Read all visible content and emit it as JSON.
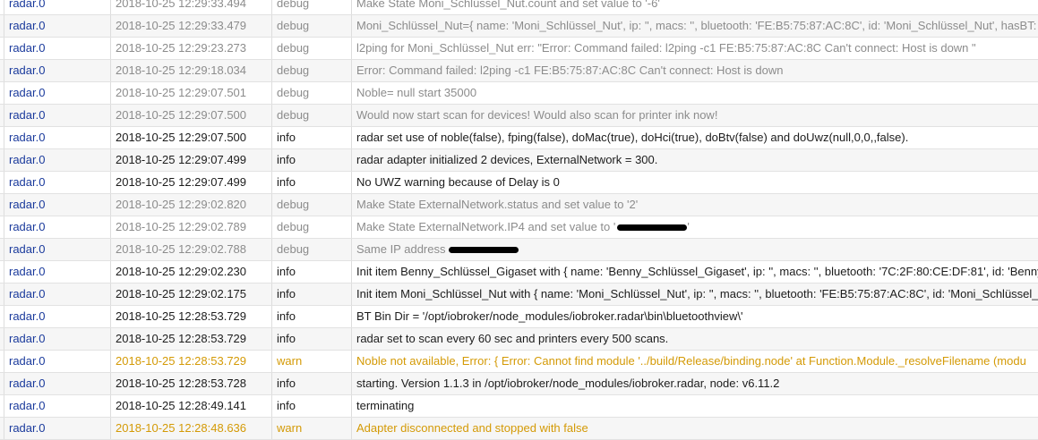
{
  "log_rows": [
    {
      "source": "radar.0",
      "time": "2018-10-25 12:29:33.494",
      "level": "debug",
      "message": "Make State Moni_Schlüssel_Nut.count and set value to '-6'"
    },
    {
      "source": "radar.0",
      "time": "2018-10-25 12:29:33.479",
      "level": "debug",
      "message": "Moni_Schlüssel_Nut={ name: 'Moni_Schlüssel_Nut', ip: '', macs: '', bluetooth: 'FE:B5:75:87:AC:8C', id: 'Moni_Schlüssel_Nut', hasBT: true"
    },
    {
      "source": "radar.0",
      "time": "2018-10-25 12:29:23.273",
      "level": "debug",
      "message": "l2ping for Moni_Schlüssel_Nut err: \"Error: Command failed: l2ping -c1 FE:B5:75:87:AC:8C Can't connect: Host is down \""
    },
    {
      "source": "radar.0",
      "time": "2018-10-25 12:29:18.034",
      "level": "debug",
      "message": "Error: Command failed: l2ping -c1 FE:B5:75:87:AC:8C Can't connect: Host is down"
    },
    {
      "source": "radar.0",
      "time": "2018-10-25 12:29:07.501",
      "level": "debug",
      "message": "Noble= null start 35000"
    },
    {
      "source": "radar.0",
      "time": "2018-10-25 12:29:07.500",
      "level": "debug",
      "message": "Would now start scan for devices! Would also scan for printer ink now!"
    },
    {
      "source": "radar.0",
      "time": "2018-10-25 12:29:07.500",
      "level": "info",
      "message": "radar set use of noble(false), fping(false), doMac(true), doHci(true), doBtv(false) and doUwz(null,0,0,,false)."
    },
    {
      "source": "radar.0",
      "time": "2018-10-25 12:29:07.499",
      "level": "info",
      "message": "radar adapter initialized 2 devices, ExternalNetwork = 300."
    },
    {
      "source": "radar.0",
      "time": "2018-10-25 12:29:07.499",
      "level": "info",
      "message": "No UWZ warning because of Delay is 0"
    },
    {
      "source": "radar.0",
      "time": "2018-10-25 12:29:02.820",
      "level": "debug",
      "message": "Make State ExternalNetwork.status and set value to '2'"
    },
    {
      "source": "radar.0",
      "time": "2018-10-25 12:29:02.789",
      "level": "debug",
      "message": "Make State ExternalNetwork.IP4 and set value to '",
      "message_tail": "'"
    },
    {
      "source": "radar.0",
      "time": "2018-10-25 12:29:02.788",
      "level": "debug",
      "message": "Same IP address"
    },
    {
      "source": "radar.0",
      "time": "2018-10-25 12:29:02.230",
      "level": "info",
      "message": "Init item Benny_Schlüssel_Gigaset with { name: 'Benny_Schlüssel_Gigaset', ip: '', macs: '', bluetooth: '7C:2F:80:CE:DF:81', id: 'Benny_Sch"
    },
    {
      "source": "radar.0",
      "time": "2018-10-25 12:29:02.175",
      "level": "info",
      "message": "Init item Moni_Schlüssel_Nut with { name: 'Moni_Schlüssel_Nut', ip: '', macs: '', bluetooth: 'FE:B5:75:87:AC:8C', id: 'Moni_Schlüssel_Nut"
    },
    {
      "source": "radar.0",
      "time": "2018-10-25 12:28:53.729",
      "level": "info",
      "message": "BT Bin Dir = '/opt/iobroker/node_modules/iobroker.radar\\bin\\bluetoothview\\'"
    },
    {
      "source": "radar.0",
      "time": "2018-10-25 12:28:53.729",
      "level": "info",
      "message": "radar set to scan every 60 sec and printers every 500 scans."
    },
    {
      "source": "radar.0",
      "time": "2018-10-25 12:28:53.729",
      "level": "warn",
      "message": "Noble not available, Error: { Error: Cannot find module '../build/Release/binding.node' at Function.Module._resolveFilename (modu"
    },
    {
      "source": "radar.0",
      "time": "2018-10-25 12:28:53.728",
      "level": "info",
      "message": "starting. Version 1.1.3 in /opt/iobroker/node_modules/iobroker.radar, node: v6.11.2"
    },
    {
      "source": "radar.0",
      "time": "2018-10-25 12:28:49.141",
      "level": "info",
      "message": "terminating"
    },
    {
      "source": "radar.0",
      "time": "2018-10-25 12:28:48.636",
      "level": "warn",
      "message": "Adapter disconnected and stopped with false"
    }
  ],
  "colors": {
    "source": "#1a3a9c",
    "debug": "#8c8c8c",
    "info": "#1c1c1c",
    "warn": "#d49a06"
  }
}
